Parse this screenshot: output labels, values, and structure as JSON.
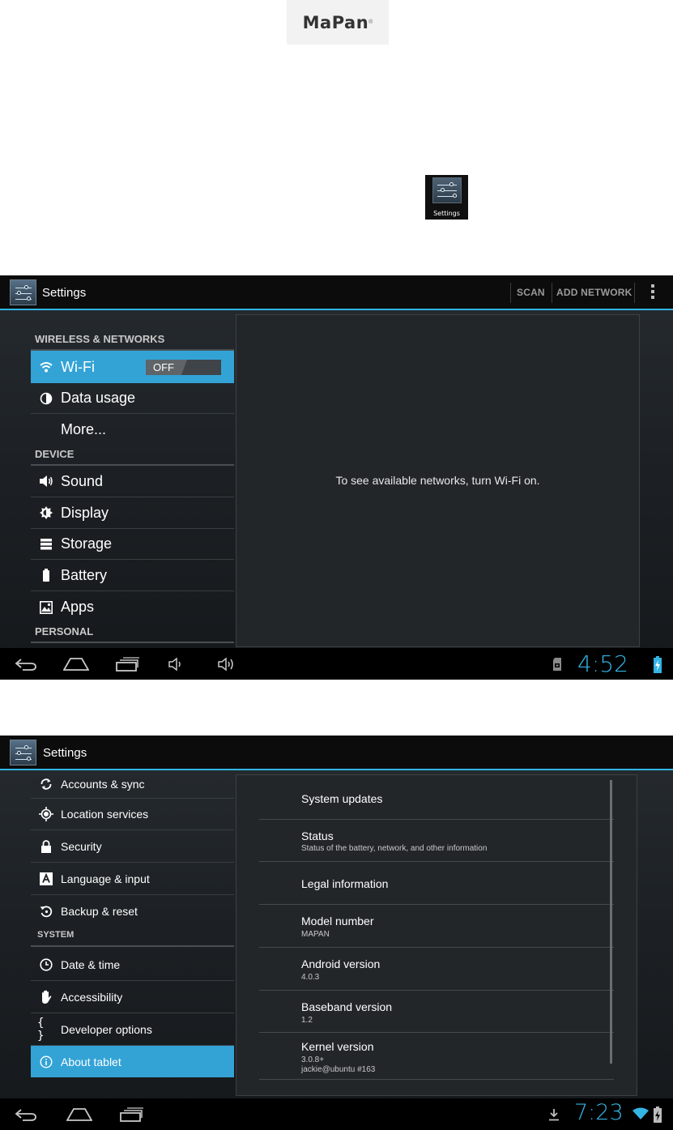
{
  "logo": {
    "text": "MaPan",
    "mark": "®"
  },
  "app_icon": {
    "name": "settings-sliders-icon",
    "label": "Settings"
  },
  "screen1": {
    "title": "Settings",
    "actions": {
      "scan": "SCAN",
      "add_network": "ADD NETWORK"
    },
    "sections": {
      "wireless": "WIRELESS & NETWORKS",
      "device": "DEVICE",
      "personal": "PERSONAL"
    },
    "items": {
      "wifi": {
        "label": "Wi-Fi",
        "icon": "wifi-icon",
        "toggle": "OFF"
      },
      "data_usage": {
        "label": "Data usage",
        "icon": "pie-chart-icon"
      },
      "more": {
        "label": "More..."
      },
      "sound": {
        "label": "Sound",
        "icon": "speaker-icon"
      },
      "display": {
        "label": "Display",
        "icon": "brightness-icon"
      },
      "storage": {
        "label": "Storage",
        "icon": "storage-icon"
      },
      "battery": {
        "label": "Battery",
        "icon": "battery-icon"
      },
      "apps": {
        "label": "Apps",
        "icon": "apps-icon"
      }
    },
    "message": "To see available networks, turn Wi-Fi on.",
    "clock": "4:52"
  },
  "screen2": {
    "title": "Settings",
    "sections": {
      "system": "SYSTEM"
    },
    "items": {
      "accounts": {
        "label": "Accounts & sync",
        "icon": "sync-icon"
      },
      "location": {
        "label": "Location services",
        "icon": "location-icon"
      },
      "security": {
        "label": "Security",
        "icon": "lock-icon"
      },
      "language": {
        "label": "Language & input",
        "icon": "language-icon"
      },
      "backup": {
        "label": "Backup & reset",
        "icon": "backup-icon"
      },
      "datetime": {
        "label": "Date & time",
        "icon": "clock-icon"
      },
      "accessibility": {
        "label": "Accessibility",
        "icon": "hand-icon"
      },
      "developer": {
        "label": "Developer options",
        "icon": "braces-icon",
        "glyph": "{ }"
      },
      "about": {
        "label": "About tablet",
        "icon": "info-icon"
      }
    },
    "about": [
      {
        "title": "System updates",
        "summary": ""
      },
      {
        "title": "Status",
        "summary": "Status of the battery, network, and other information"
      },
      {
        "title": "Legal information",
        "summary": ""
      },
      {
        "title": "Model number",
        "summary": "MAPAN"
      },
      {
        "title": "Android version",
        "summary": "4.0.3"
      },
      {
        "title": "Baseband version",
        "summary": "1.2"
      },
      {
        "title": "Kernel version",
        "summary": "3.0.8+",
        "summary2": "jackie@ubuntu #163"
      }
    ],
    "clock": "7:23"
  },
  "colors": {
    "accent": "#33b5e5",
    "selected": "#33a3d6"
  }
}
